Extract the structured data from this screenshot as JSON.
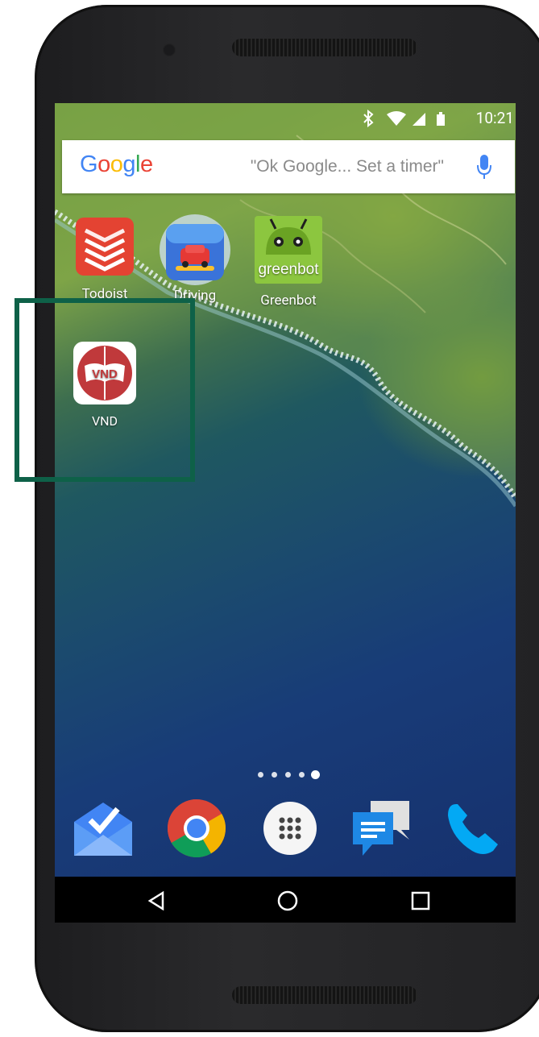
{
  "status_bar": {
    "time": "10:21",
    "icons": [
      "bluetooth-icon",
      "wifi-icon",
      "signal-icon",
      "battery-icon"
    ]
  },
  "search": {
    "logo": "Google",
    "hint": "\"Ok Google... Set a timer\"",
    "mic_icon": "mic-icon"
  },
  "home_apps": [
    {
      "label": "Todoist",
      "icon": "todoist-icon"
    },
    {
      "label": "Driving",
      "icon": "driving-icon"
    },
    {
      "label": "Greenbot",
      "icon": "greenbot-icon"
    },
    {
      "label": "VND",
      "icon": "vnd-icon"
    }
  ],
  "greenbot_logo_text": "greenbot",
  "vnd_logo_text": "VND",
  "page_indicator": {
    "pages": 5,
    "current": 5
  },
  "dock": [
    {
      "name": "inbox",
      "icon": "inbox-icon"
    },
    {
      "name": "chrome",
      "icon": "chrome-icon"
    },
    {
      "name": "app-drawer",
      "icon": "app-drawer-icon"
    },
    {
      "name": "messenger",
      "icon": "messenger-icon"
    },
    {
      "name": "phone",
      "icon": "phone-icon"
    }
  ],
  "nav_bar": [
    "back-icon",
    "home-icon",
    "recents-icon"
  ],
  "colors": {
    "highlight_border": "#0e6148",
    "vnd_red": "#c0393b",
    "todoist_red": "#e44332",
    "greenbot_green": "#8cc63f"
  }
}
